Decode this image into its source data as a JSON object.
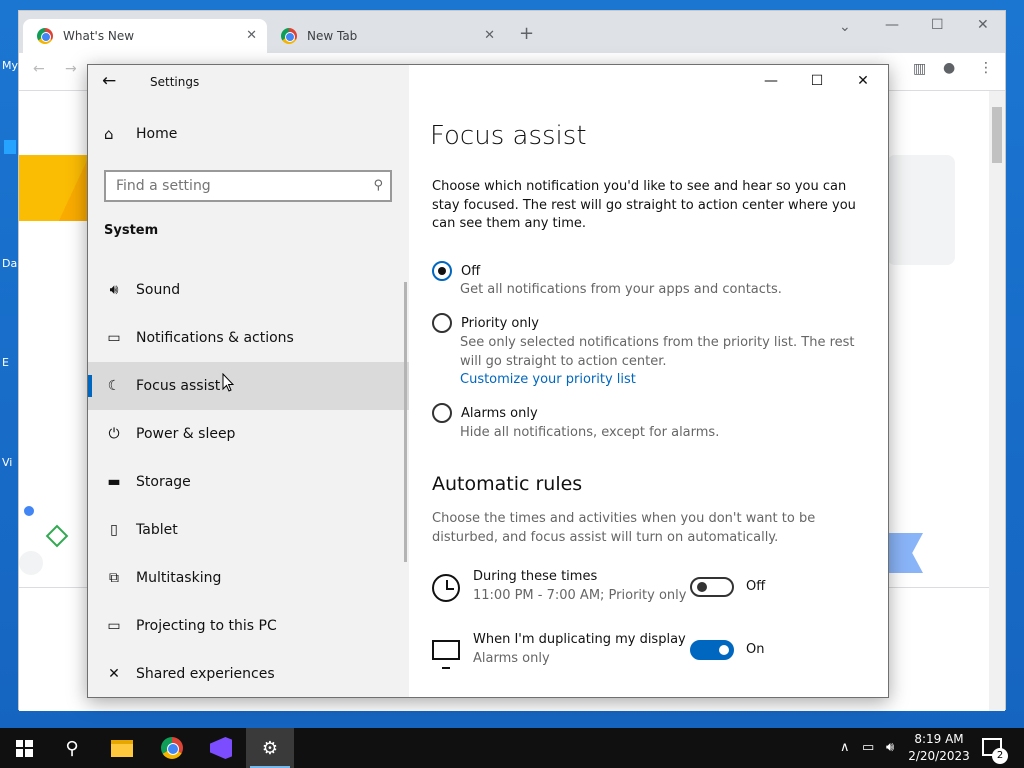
{
  "desktop": {
    "labels": [
      "My",
      "Da",
      "E",
      "Vi"
    ]
  },
  "chrome": {
    "tabs": [
      {
        "label": "What's New",
        "active": true
      },
      {
        "label": "New Tab",
        "active": false
      }
    ]
  },
  "settings": {
    "window_title": "Settings",
    "home_label": "Home",
    "search_placeholder": "Find a setting",
    "section": "System",
    "nav": [
      {
        "label": "Sound",
        "icon": "speaker-icon",
        "glyph": "🔊︎"
      },
      {
        "label": "Notifications & actions",
        "icon": "notification-icon",
        "glyph": "▭"
      },
      {
        "label": "Focus assist",
        "icon": "moon-icon",
        "glyph": "☾",
        "selected": true
      },
      {
        "label": "Power & sleep",
        "icon": "power-icon",
        "glyph": "⏻"
      },
      {
        "label": "Storage",
        "icon": "storage-icon",
        "glyph": "▬"
      },
      {
        "label": "Tablet",
        "icon": "tablet-icon",
        "glyph": "▯"
      },
      {
        "label": "Multitasking",
        "icon": "multitasking-icon",
        "glyph": "⧉"
      },
      {
        "label": "Projecting to this PC",
        "icon": "projector-icon",
        "glyph": "▭"
      },
      {
        "label": "Shared experiences",
        "icon": "share-icon",
        "glyph": "✕"
      }
    ],
    "page_title": "Focus assist",
    "description": "Choose which notification you'd like to see and hear so you can stay focused. The rest will go straight to action center where you can see them any time.",
    "options": [
      {
        "label": "Off",
        "desc": "Get all notifications from your apps and contacts.",
        "selected": true
      },
      {
        "label": "Priority only",
        "desc": "See only selected notifications from the priority list. The rest will go straight to action center.",
        "link": "Customize your priority list",
        "selected": false
      },
      {
        "label": "Alarms only",
        "desc": "Hide all notifications, except for alarms.",
        "selected": false
      }
    ],
    "auto_rules_title": "Automatic rules",
    "auto_rules_desc": "Choose the times and activities when you don't want to be disturbed, and focus assist will turn on automatically.",
    "rules": [
      {
        "title": "During these times",
        "sub": "11:00 PM - 7:00 AM; Priority only",
        "state": "Off",
        "on": false
      },
      {
        "title": "When I'm duplicating my display",
        "sub": "Alarms only",
        "state": "On",
        "on": true
      }
    ]
  },
  "taskbar": {
    "time": "8:19 AM",
    "date": "2/20/2023",
    "notification_count": "2"
  },
  "colors": {
    "accent": "#0067c0",
    "desktop": "#1565c0",
    "taskbar": "#101010"
  }
}
